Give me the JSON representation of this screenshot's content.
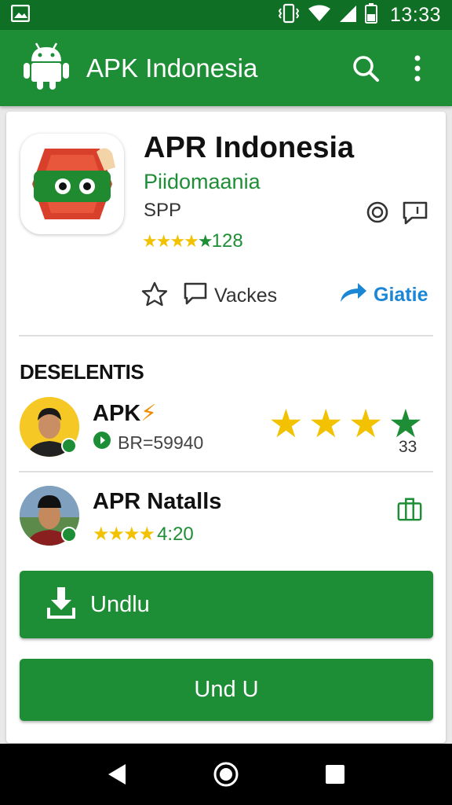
{
  "status_bar": {
    "time": "13:33",
    "icons": [
      "image-icon",
      "vibrate-icon",
      "wifi-icon",
      "signal-icon",
      "battery-icon"
    ]
  },
  "app_bar": {
    "title": "APK Indonesia",
    "icons": [
      "android-icon",
      "search-icon",
      "more-vert-icon"
    ],
    "color": "#1e8e36"
  },
  "app_header": {
    "title": "APR Indonesia",
    "developer": "Piidomaania",
    "category": "SPP",
    "rating_count": "128",
    "stars": 5
  },
  "actions": {
    "vackes_label": "Vackes",
    "share_label": "Giatie"
  },
  "section": {
    "title": "DESELENTIS"
  },
  "reviews": [
    {
      "name": "APK",
      "sub": "BR=59940",
      "stars": 4,
      "count": "33"
    },
    {
      "name": "APR Natalls",
      "rating": "4:20",
      "stars": 4
    }
  ],
  "buttons": {
    "primary_label": "Undlu",
    "secondary_label": "Und U"
  },
  "colors": {
    "accent": "#1e8e36",
    "status_bar": "#0f6f24",
    "star": "#f2c200",
    "share": "#1a86d6"
  }
}
